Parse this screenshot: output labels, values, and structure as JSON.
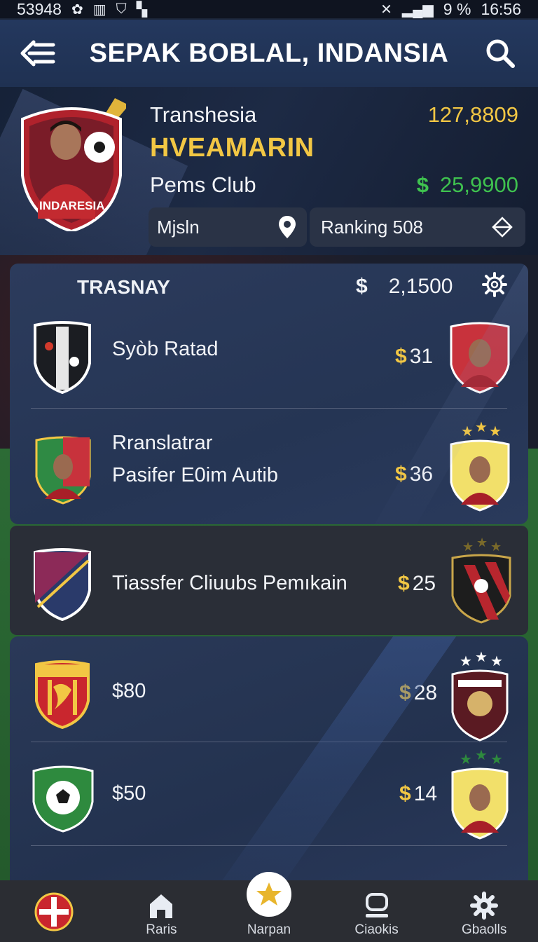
{
  "status_bar": {
    "left_text": "53948",
    "battery": "9 %",
    "time": "16:56"
  },
  "header": {
    "title": "SEPAK BOBLAL, INDANSIA"
  },
  "profile": {
    "name": "Transhesia",
    "club_name": "HVEAMARIN",
    "club": "Pems Club",
    "stat": "127,8809",
    "money": "25,9900",
    "money_symbol": "$",
    "badge_text": "INDARESIA",
    "chip_location": "Mjsln",
    "chip_ranking": "Ranking 508"
  },
  "transfer_panel": {
    "title": "TRASNAY",
    "amount_symbol": "$",
    "amount": "2,1500",
    "rows": [
      {
        "label_1": "Syòb Ratad",
        "label_2": "",
        "price": "31"
      },
      {
        "label_1": "Rranslatrar",
        "label_2": "Pasifer E0im Autib",
        "price": "36"
      },
      {
        "label_1": "Tiassfer Cliuubs Pemıkain",
        "label_2": "",
        "price": "25"
      },
      {
        "label_1": "$80",
        "label_2": "",
        "price": "28"
      },
      {
        "label_1": "$50",
        "label_2": "",
        "price": "14"
      }
    ],
    "coin_symbol": "$"
  },
  "bottom_nav": {
    "items": [
      {
        "label": "",
        "icon": "club-crest-icon"
      },
      {
        "label": "Raris",
        "icon": "home-icon"
      },
      {
        "label": "Narpan",
        "icon": "star-icon"
      },
      {
        "label": "Ciaokis",
        "icon": "person-icon"
      },
      {
        "label": "Gbaolls",
        "icon": "gear-icon"
      }
    ]
  },
  "colors": {
    "accent_gold": "#f2c744",
    "money_green": "#3fc24f",
    "header_blue": "#24385e"
  }
}
